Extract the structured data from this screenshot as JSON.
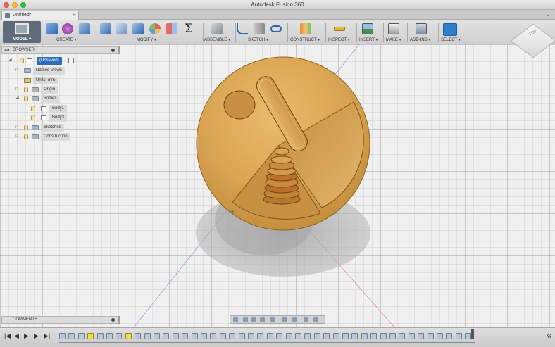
{
  "window": {
    "title": "Autodesk Fusion 360"
  },
  "tab": {
    "name": "Untitled*",
    "close": "×"
  },
  "tabbar": {
    "chevron": "⌄"
  },
  "workspace": {
    "label": "MODEL ▾"
  },
  "toolbar": {
    "groups": [
      {
        "label": "CREATE ▾"
      },
      {
        "label": "MODIFY ▾"
      },
      {
        "label": "ASSEMBLE ▾"
      },
      {
        "label": "SKETCH ▾"
      },
      {
        "label": "CONSTRUCT ▾"
      },
      {
        "label": "INSPECT ▾"
      },
      {
        "label": "INSERT ▾"
      },
      {
        "label": "MAKE ▾"
      },
      {
        "label": "ADD-INS ▾"
      },
      {
        "label": "SELECT ▾"
      }
    ],
    "sigma": "Σ"
  },
  "browser": {
    "title": "BROWSER",
    "collapse": "◂◂",
    "items": [
      {
        "label": "(Unsaved)",
        "arrow": "◢"
      },
      {
        "label": "Named Views",
        "arrow": "▷"
      },
      {
        "label": "Units: mm",
        "arrow": ""
      },
      {
        "label": "Origin",
        "arrow": "▷"
      },
      {
        "label": "Bodies",
        "arrow": "◢"
      },
      {
        "label": "Body1",
        "arrow": ""
      },
      {
        "label": "Body3",
        "arrow": ""
      },
      {
        "label": "Sketches",
        "arrow": "▷"
      },
      {
        "label": "Construction",
        "arrow": "▷"
      }
    ]
  },
  "viewcube": {
    "label": "TOP"
  },
  "comments": {
    "title": "COMMENTS"
  },
  "timeline": {
    "controls": [
      "|◀",
      "◀",
      "▶",
      "▶|"
    ],
    "gear": "⚙"
  },
  "colors": {
    "wood": "#d9a451",
    "wood_dark": "#b07d30",
    "accent": "#2c6fb8",
    "axis_red": "#e58a8a",
    "axis_blue": "#8a9de5"
  }
}
